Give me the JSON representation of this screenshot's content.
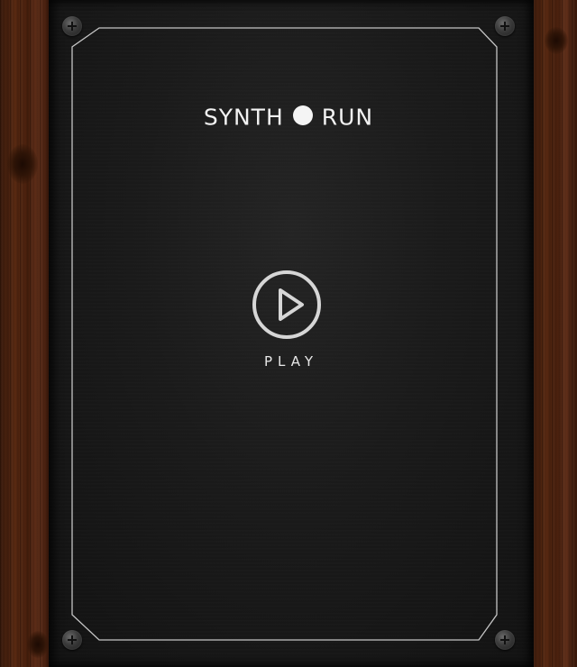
{
  "game": {
    "title_left": "SYNTH",
    "title_right": "RUN",
    "play_label": "PLAY"
  },
  "icons": {
    "title_separator": "filled-circle-icon",
    "play": "play-circle-icon",
    "screws": "screw-icon"
  },
  "colors": {
    "board": "#1a1a1a",
    "chalk": "#f2f2f2",
    "wood": "#4a200d"
  }
}
